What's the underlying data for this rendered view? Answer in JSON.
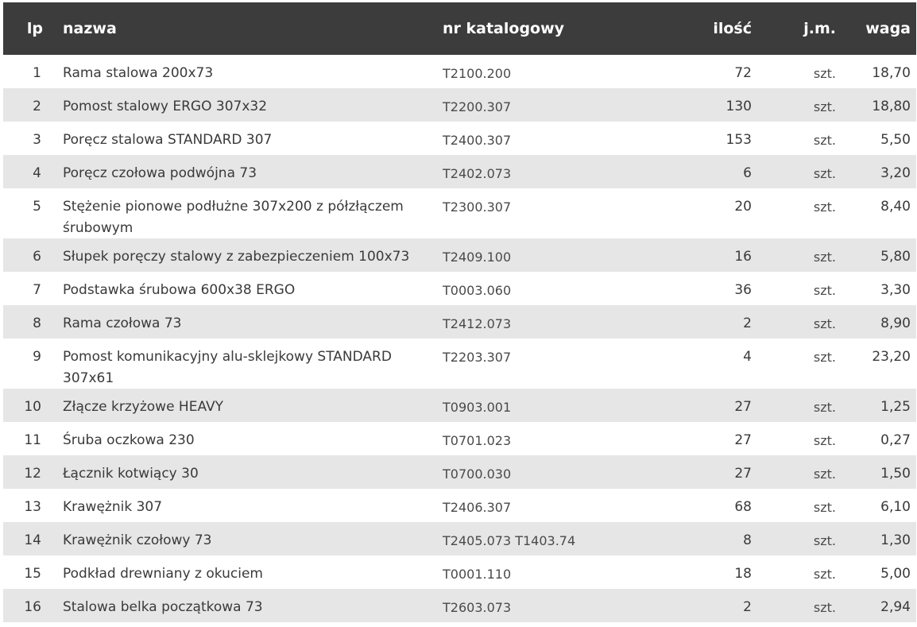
{
  "headers": {
    "lp": "lp",
    "name": "nazwa",
    "catalog": "nr katalogowy",
    "qty": "ilość",
    "unit": "j.m.",
    "weight": "waga"
  },
  "rows": [
    {
      "lp": "1",
      "name": "Rama stalowa 200x73",
      "catalog": "T2100.200",
      "qty": "72",
      "unit": "szt.",
      "weight": "18,70"
    },
    {
      "lp": "2",
      "name": "Pomost stalowy ERGO 307x32",
      "catalog": "T2200.307",
      "qty": "130",
      "unit": "szt.",
      "weight": "18,80"
    },
    {
      "lp": "3",
      "name": "Poręcz stalowa STANDARD 307",
      "catalog": "T2400.307",
      "qty": "153",
      "unit": "szt.",
      "weight": "5,50"
    },
    {
      "lp": "4",
      "name": "Poręcz czołowa podwójna 73",
      "catalog": "T2402.073",
      "qty": "6",
      "unit": "szt.",
      "weight": "3,20"
    },
    {
      "lp": "5",
      "name": "Stężenie pionowe podłużne 307x200 z półzłączem śrubowym",
      "catalog": "T2300.307",
      "qty": "20",
      "unit": "szt.",
      "weight": "8,40"
    },
    {
      "lp": "6",
      "name": "Słupek poręczy stalowy z zabezpieczeniem 100x73",
      "catalog": "T2409.100",
      "qty": "16",
      "unit": "szt.",
      "weight": "5,80"
    },
    {
      "lp": "7",
      "name": "Podstawka śrubowa 600x38 ERGO",
      "catalog": "T0003.060",
      "qty": "36",
      "unit": "szt.",
      "weight": "3,30"
    },
    {
      "lp": "8",
      "name": "Rama czołowa 73",
      "catalog": "T2412.073",
      "qty": "2",
      "unit": "szt.",
      "weight": "8,90"
    },
    {
      "lp": "9",
      "name": "Pomost komunikacyjny alu-sklejkowy STANDARD 307x61",
      "catalog": "T2203.307",
      "qty": "4",
      "unit": "szt.",
      "weight": "23,20"
    },
    {
      "lp": "10",
      "name": "Złącze krzyżowe HEAVY",
      "catalog": "T0903.001",
      "qty": "27",
      "unit": "szt.",
      "weight": "1,25"
    },
    {
      "lp": "11",
      "name": "Śruba oczkowa 230",
      "catalog": "T0701.023",
      "qty": "27",
      "unit": "szt.",
      "weight": "0,27"
    },
    {
      "lp": "12",
      "name": "Łącznik kotwiący 30",
      "catalog": "T0700.030",
      "qty": "27",
      "unit": "szt.",
      "weight": "1,50"
    },
    {
      "lp": "13",
      "name": "Krawężnik 307",
      "catalog": "T2406.307",
      "qty": "68",
      "unit": "szt.",
      "weight": "6,10"
    },
    {
      "lp": "14",
      "name": "Krawężnik czołowy 73",
      "catalog": "T2405.073  T1403.74",
      "qty": "8",
      "unit": "szt.",
      "weight": "1,30"
    },
    {
      "lp": "15",
      "name": "Podkład drewniany z okuciem",
      "catalog": "T0001.110",
      "qty": "18",
      "unit": "szt.",
      "weight": "5,00"
    },
    {
      "lp": "16",
      "name": "Stalowa belka początkowa 73",
      "catalog": "T2603.073",
      "qty": "2",
      "unit": "szt.",
      "weight": "2,94"
    }
  ]
}
